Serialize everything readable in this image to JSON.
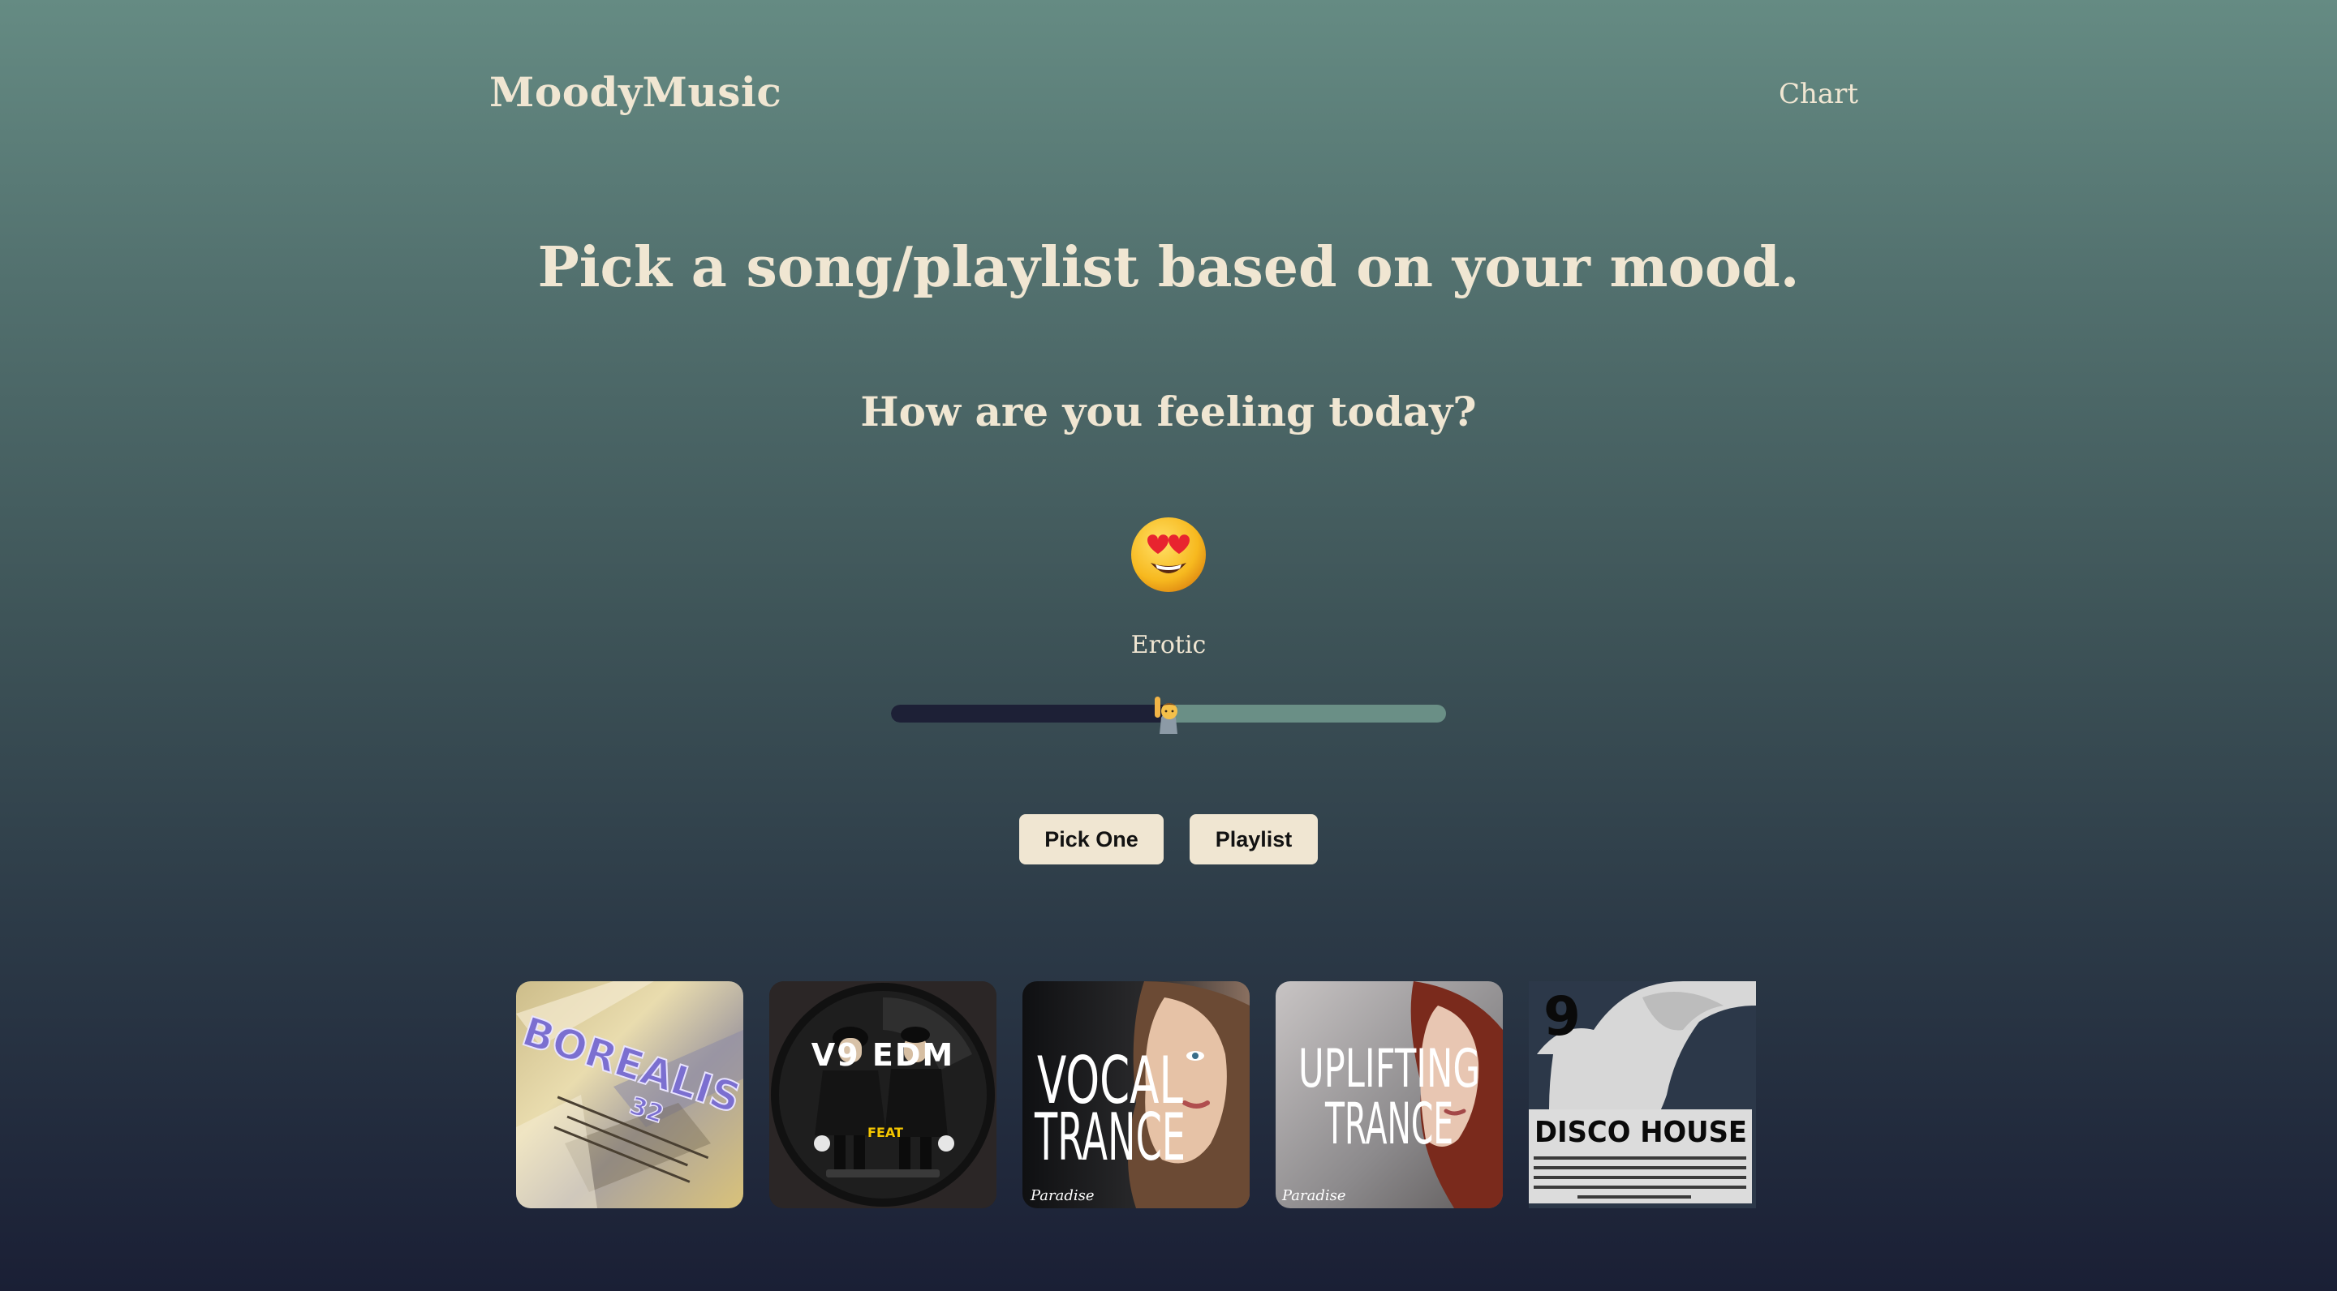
{
  "header": {
    "brand": "MoodyMusic",
    "nav_link": "Chart"
  },
  "main": {
    "headline": "Pick a song/playlist based on your mood.",
    "question": "How are you feeling today?",
    "mood_emoji": "smiling-face-with-heart-eyes",
    "mood_label": "Erotic",
    "slider_value_percent": 50,
    "slider_thumb_icon": "person-raising-hand-icon",
    "buttons": {
      "pick_one": "Pick One",
      "playlist": "Playlist"
    }
  },
  "albums": [
    {
      "cover_text": [
        "BOREALIS",
        "32"
      ],
      "icon": "album-cover-borealis"
    },
    {
      "cover_text": [
        "V9 EDM",
        "FEAT"
      ],
      "icon": "album-cover-v9-edm"
    },
    {
      "cover_text": [
        "VOCAL",
        "TRANCE",
        "Paradise"
      ],
      "icon": "album-cover-vocal-trance"
    },
    {
      "cover_text": [
        "UPLIFTING",
        "TRANCE",
        "Paradise"
      ],
      "icon": "album-cover-uplifting-trance"
    },
    {
      "cover_text": [
        "9",
        "DISCO HOUSE"
      ],
      "icon": "album-cover-disco-house"
    }
  ],
  "colors": {
    "cream": "#f0e6d2",
    "slider_fill": "#1d2036",
    "slider_track": "#6a8f86"
  }
}
